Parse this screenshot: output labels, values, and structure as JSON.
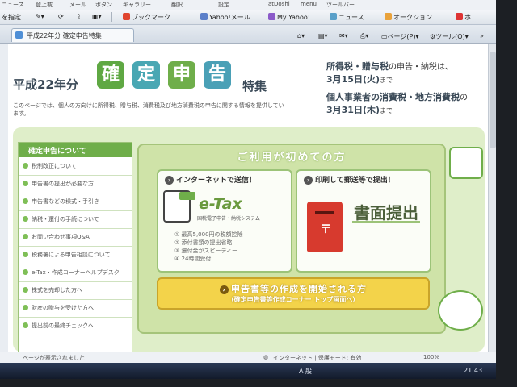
{
  "menubar": {
    "items": [
      "ニュース",
      "登上載",
      "メール",
      "ボタン",
      "ギャラリー",
      "翻訳",
      "設定",
      "atDoshi",
      "menu",
      "ツールバー"
    ]
  },
  "toolbar": {
    "items": [
      "を指定",
      "ブックマーク",
      "Yahoo!メール",
      "My Yahoo!",
      "ニュース",
      "オークション",
      "ホ"
    ]
  },
  "tab": {
    "title": "平成22年分 確定申告特集"
  },
  "commands": {
    "page": "ページ(P)",
    "tools": "ツール(O)"
  },
  "header": {
    "year": "平成22年分",
    "kanji": [
      "確",
      "定",
      "申",
      "告"
    ],
    "tokushu": "特集",
    "intro": "このページでは、個人の方向けに所得税、贈与税、消費税及び地方消費税の申告に関する情報を提供しています。",
    "deadline1_label": "所得税・贈与税",
    "deadline1_suffix": "の申告・納税は、",
    "deadline1_date": "3月15日(火)",
    "deadline2_label": "個人事業者の消費税・地方消費税",
    "deadline2_suffix": "の",
    "deadline2_date": "3月31日(木)",
    "until": "まで"
  },
  "sidebar": {
    "heading": "確定申告について",
    "items": [
      "税制改正について",
      "申告書の提出が必要な方",
      "申告書などの様式・手引き",
      "納税・還付の手続について",
      "お問い合わせ事項Q&A",
      "税務署による申告相談について",
      "e-Tax・作成コーナーヘルプデスク",
      "株式を売却した方へ",
      "財産の贈与を受けた方へ",
      "提出前の最終チェックへ"
    ]
  },
  "panel": {
    "first_time": "ご利用が初めての方",
    "internet": {
      "title": "インターネットで送信！",
      "logo": "e-Tax",
      "subtitle": "国税電子申告・納税システム",
      "benefits": [
        "① 最高5,000円の税額控除",
        "② 添付書類の提出省略",
        "③ 還付金がスピーディー",
        "④ 24時間受付"
      ]
    },
    "print": {
      "title": "印刷して郵送等で提出！",
      "label": "書面提出",
      "postmark": "〒"
    },
    "start": {
      "label": "申告書等の作成を開始される方",
      "sub": "（確定申告書等作成コーナー トップ画面へ）"
    }
  },
  "status": {
    "left": "ページが表示されました",
    "zone": "インターネット | 保護モード: 有効",
    "zoom": "100%"
  },
  "taskbar": {
    "tray": "A 般 ",
    "clock": "21:43"
  },
  "colors": {
    "green": "#6fae4a",
    "kanji": [
      "#5fa843",
      "#49a7b3",
      "#6fae4a",
      "#4aa0b6"
    ],
    "button": "#f3d34a",
    "postbox": "#d73a2e"
  }
}
